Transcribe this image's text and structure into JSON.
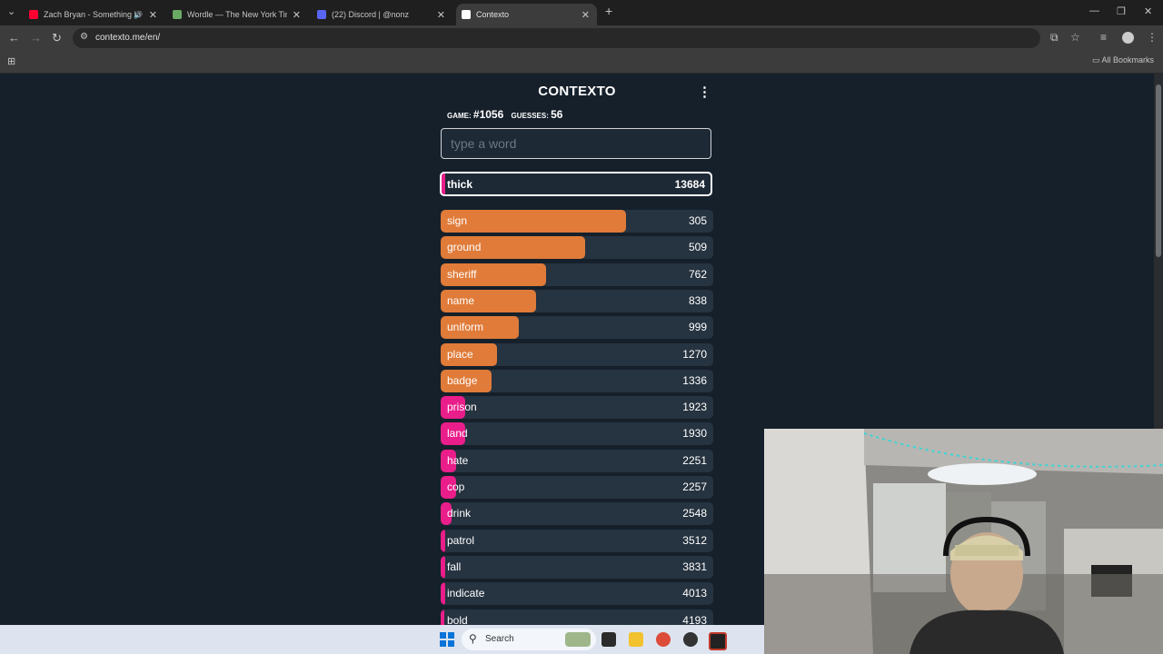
{
  "browser": {
    "tabs": [
      {
        "title": "Zach Bryan - Something In",
        "favicon_color": "#ff0033",
        "icon": "youtube-icon",
        "audio": true
      },
      {
        "title": "Wordle — The New York Times",
        "favicon_color": "#6aaa64",
        "icon": "wordle-icon"
      },
      {
        "title": "(22) Discord | @nonz",
        "favicon_color": "#5865f2",
        "icon": "discord-icon"
      },
      {
        "title": "Contexto",
        "favicon_color": "#ffffff",
        "icon": "contexto-icon"
      }
    ],
    "url": "contexto.me/en/",
    "bookmarks_label": "All Bookmarks"
  },
  "game": {
    "title": "CONTEXTO",
    "game_label": "GAME:",
    "game_number": "#1056",
    "guesses_label": "GUESSES:",
    "guesses_count": "56",
    "input_placeholder": "type a word",
    "latest": {
      "word": "thick",
      "rank": "13684"
    },
    "guesses": [
      {
        "word": "sign",
        "rank": "305",
        "fill": 0.68,
        "color": "#e07b39"
      },
      {
        "word": "ground",
        "rank": "509",
        "fill": 0.53,
        "color": "#e07b39"
      },
      {
        "word": "sheriff",
        "rank": "762",
        "fill": 0.385,
        "color": "#e07b39"
      },
      {
        "word": "name",
        "rank": "838",
        "fill": 0.35,
        "color": "#e07b39"
      },
      {
        "word": "uniform",
        "rank": "999",
        "fill": 0.285,
        "color": "#e07b39"
      },
      {
        "word": "place",
        "rank": "1270",
        "fill": 0.205,
        "color": "#e07b39"
      },
      {
        "word": "badge",
        "rank": "1336",
        "fill": 0.185,
        "color": "#e07b39"
      },
      {
        "word": "prison",
        "rank": "1923",
        "fill": 0.09,
        "color": "#e91e8a"
      },
      {
        "word": "land",
        "rank": "1930",
        "fill": 0.09,
        "color": "#e91e8a"
      },
      {
        "word": "hate",
        "rank": "2251",
        "fill": 0.055,
        "color": "#e91e8a"
      },
      {
        "word": "cop",
        "rank": "2257",
        "fill": 0.055,
        "color": "#e91e8a"
      },
      {
        "word": "drink",
        "rank": "2548",
        "fill": 0.04,
        "color": "#e91e8a"
      },
      {
        "word": "patrol",
        "rank": "3512",
        "fill": 0.018,
        "color": "#e91e8a"
      },
      {
        "word": "fall",
        "rank": "3831",
        "fill": 0.016,
        "color": "#e91e8a"
      },
      {
        "word": "indicate",
        "rank": "4013",
        "fill": 0.015,
        "color": "#e91e8a"
      },
      {
        "word": "bold",
        "rank": "4193",
        "fill": 0.014,
        "color": "#e91e8a"
      }
    ]
  },
  "taskbar": {
    "search_label": "Search"
  }
}
